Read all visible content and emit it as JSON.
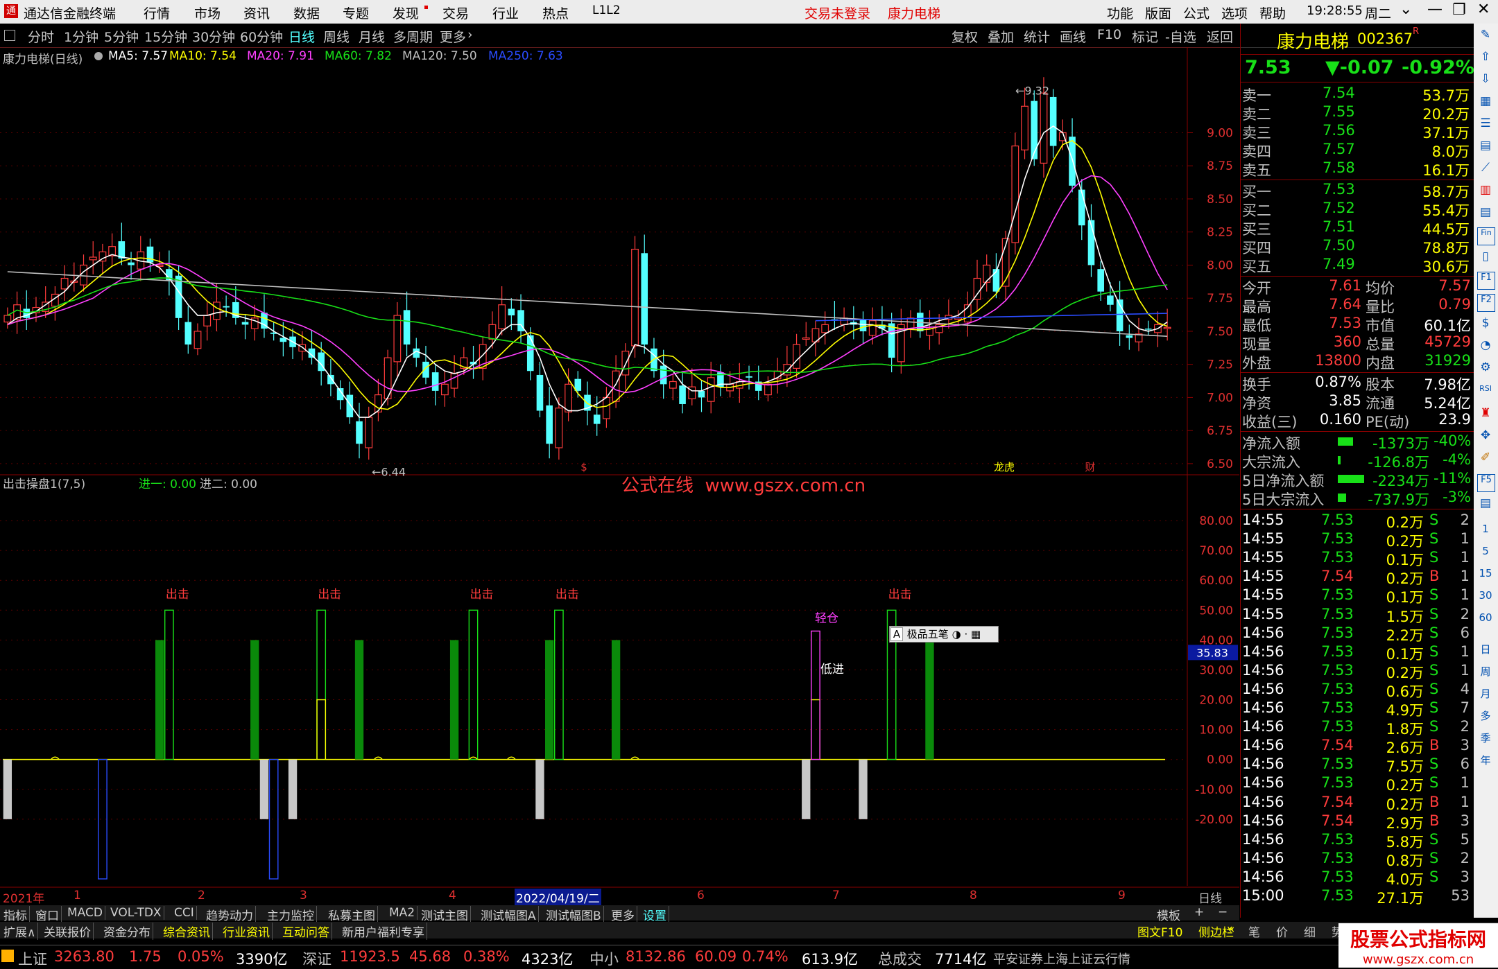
{
  "menubar": {
    "app_title": "通达信金融终端",
    "items": [
      "行情",
      "市场",
      "资讯",
      "数据",
      "专题",
      "发现",
      "交易",
      "行业",
      "热点",
      "L1L2"
    ],
    "login_status": "交易未登录",
    "stock_name": "康力电梯",
    "right_items": [
      "功能",
      "版面",
      "公式",
      "选项",
      "帮助"
    ],
    "time": "19:28:55",
    "weekday": "周二"
  },
  "toolbar": {
    "periods": [
      "分时",
      "1分钟",
      "5分钟",
      "15分钟",
      "30分钟",
      "60分钟",
      "日线",
      "周线",
      "月线",
      "多周期",
      "更多"
    ],
    "active_period": "日线",
    "right_buttons": [
      "复权",
      "叠加",
      "统计",
      "画线",
      "F10",
      "标记",
      "-自选",
      "返回"
    ]
  },
  "ma_line": {
    "title": "康力电梯(日线)",
    "ma5": "MA5: 7.57",
    "ma10": "MA10: 7.54",
    "ma20": "MA20: 7.91",
    "ma60": "MA60: 7.82",
    "ma120": "MA120: 7.50",
    "ma250": "MA250: 7.63"
  },
  "price_axis": [
    "9.00",
    "8.75",
    "8.50",
    "8.25",
    "8.00",
    "7.75",
    "7.50",
    "7.25",
    "7.00",
    "6.75",
    "6.50"
  ],
  "price_annotations": {
    "high": "9.32",
    "low": "6.44"
  },
  "event_markers": [
    "$",
    "龙虎",
    "财"
  ],
  "indicator": {
    "title": "出击操盘1(7,5)",
    "jin1": "进一: 0.00",
    "jin2": "进二: 0.00",
    "axis": [
      "80.00",
      "70.00",
      "60.00",
      "50.00",
      "40.00",
      "30.00",
      "20.00",
      "10.00",
      "0.00",
      "-10.00",
      "-20.00"
    ],
    "current_value": "35.83",
    "labels": {
      "chuji": "出击",
      "qingcang": "轻仓",
      "dijin": "低进"
    }
  },
  "watermark": "公式在线  www.gszx.com.cn",
  "popup": {
    "label": "极品五笔"
  },
  "date_axis": {
    "labels": [
      "2021年",
      "1",
      "2",
      "3",
      "4",
      "2022/04/19/二",
      "6",
      "7",
      "8",
      "9"
    ],
    "period": "日线"
  },
  "quote": {
    "name": "康力电梯",
    "code": "002367",
    "price": "7.53",
    "change": "▼-0.07",
    "pct": "-0.92%",
    "asks": [
      {
        "label": "卖五",
        "price": "7.58",
        "vol": "16.1万"
      },
      {
        "label": "卖四",
        "price": "7.57",
        "vol": "8.0万"
      },
      {
        "label": "卖三",
        "price": "7.56",
        "vol": "37.1万"
      },
      {
        "label": "卖二",
        "price": "7.55",
        "vol": "20.2万"
      },
      {
        "label": "卖一",
        "price": "7.54",
        "vol": "53.7万"
      }
    ],
    "bids": [
      {
        "label": "买一",
        "price": "7.53",
        "vol": "58.7万"
      },
      {
        "label": "买二",
        "price": "7.52",
        "vol": "55.4万"
      },
      {
        "label": "买三",
        "price": "7.51",
        "vol": "44.5万"
      },
      {
        "label": "买四",
        "price": "7.50",
        "vol": "78.8万"
      },
      {
        "label": "买五",
        "price": "7.49",
        "vol": "30.6万"
      }
    ],
    "stats": [
      {
        "l1": "今开",
        "v1": "7.61",
        "l2": "均价",
        "v2": "7.57"
      },
      {
        "l1": "最高",
        "v1": "7.64",
        "l2": "量比",
        "v2": "0.79"
      },
      {
        "l1": "最低",
        "v1": "7.53",
        "l2": "市值",
        "v2": "60.1亿"
      },
      {
        "l1": "现量",
        "v1": "360",
        "l2": "总量",
        "v2": "45729"
      },
      {
        "l1": "外盘",
        "v1": "13800",
        "l2": "内盘",
        "v2": "31929"
      }
    ],
    "stats2": [
      {
        "l1": "换手",
        "v1": "0.87%",
        "l2": "股本",
        "v2": "7.98亿"
      },
      {
        "l1": "净资",
        "v1": "3.85",
        "l2": "流通",
        "v2": "5.24亿"
      },
      {
        "l1": "收益(三)",
        "v1": "0.160",
        "l2": "PE(动)",
        "v2": "23.9"
      }
    ],
    "flows": [
      {
        "label": "净流入额",
        "value": "-1373万",
        "pct": "-40%"
      },
      {
        "label": "大宗流入",
        "value": "-126.8万",
        "pct": "-4%"
      },
      {
        "label": "5日净流入额",
        "value": "-2234万",
        "pct": "-11%"
      },
      {
        "label": "5日大宗流入",
        "value": "-737.9万",
        "pct": "-3%"
      }
    ],
    "ticks": [
      [
        "14:55",
        "7.53",
        "0.2万",
        "S",
        "2"
      ],
      [
        "14:55",
        "7.53",
        "0.2万",
        "S",
        "1"
      ],
      [
        "14:55",
        "7.53",
        "0.1万",
        "S",
        "1"
      ],
      [
        "14:55",
        "7.54",
        "0.2万",
        "B",
        "1"
      ],
      [
        "14:55",
        "7.53",
        "0.1万",
        "S",
        "1"
      ],
      [
        "14:55",
        "7.53",
        "1.5万",
        "S",
        "2"
      ],
      [
        "14:56",
        "7.53",
        "2.2万",
        "S",
        "6"
      ],
      [
        "14:56",
        "7.53",
        "0.1万",
        "S",
        "1"
      ],
      [
        "14:56",
        "7.53",
        "0.2万",
        "S",
        "1"
      ],
      [
        "14:56",
        "7.53",
        "0.6万",
        "S",
        "4"
      ],
      [
        "14:56",
        "7.53",
        "4.9万",
        "S",
        "7"
      ],
      [
        "14:56",
        "7.53",
        "1.8万",
        "S",
        "2"
      ],
      [
        "14:56",
        "7.54",
        "2.6万",
        "B",
        "3"
      ],
      [
        "14:56",
        "7.53",
        "7.5万",
        "S",
        "6"
      ],
      [
        "14:56",
        "7.53",
        "0.2万",
        "S",
        "1"
      ],
      [
        "14:56",
        "7.54",
        "0.2万",
        "B",
        "1"
      ],
      [
        "14:56",
        "7.54",
        "2.9万",
        "B",
        "3"
      ],
      [
        "14:56",
        "7.53",
        "5.8万",
        "S",
        "5"
      ],
      [
        "14:56",
        "7.53",
        "0.8万",
        "S",
        "2"
      ],
      [
        "14:56",
        "7.53",
        "4.0万",
        "S",
        "3"
      ],
      [
        "15:00",
        "7.53",
        "27.1万",
        "",
        "53"
      ]
    ]
  },
  "right_side_icons": [
    "1",
    "5",
    "15",
    "30",
    "60",
    "日",
    "周",
    "月",
    "多",
    "季",
    "年"
  ],
  "bottom_tabs": [
    "指标",
    "窗口",
    "MACD",
    "VOL-TDX",
    "CCI",
    "趋势动力",
    "主力监控",
    "私募主图",
    "MA2",
    "测试主图",
    "测试幅图A",
    "测试幅图B",
    "更多",
    "设置"
  ],
  "bottom_tabs_right": "模板",
  "bottom_tabs2": [
    "扩展∧",
    "关联报价",
    "资金分布",
    "综合资讯",
    "行业资讯",
    "互动问答",
    "新用户福利专享"
  ],
  "bottom_tabs2_right": [
    "图文F10",
    "侧边栏",
    "笔",
    "价",
    "细",
    "势"
  ],
  "statusbar": {
    "sh_label": "上证",
    "sh_val": "3263.80",
    "sh_chg": "1.75",
    "sh_pct": "0.05%",
    "sh_amt": "3390亿",
    "sz_label": "深证",
    "sz_val": "11923.5",
    "sz_chg": "45.68",
    "sz_pct": "0.38%",
    "sz_amt": "4323亿",
    "zx_label": "中小",
    "zx_val": "8132.86",
    "zx_chg": "60.09",
    "zx_pct": "0.74%",
    "zx_amt": "613.9亿",
    "total_label": "总成交",
    "total_val": "7714亿",
    "broker": "平安证券上海上证云行情",
    "site_logo": "股票公式指标网",
    "site_url": "www.gszx.com.cn"
  },
  "chart_data": {
    "type": "candlestick",
    "colors": {
      "up": "#ff3c3c",
      "down": "#54ffff",
      "ma5": "#ffffff",
      "ma10": "#ffff00",
      "ma20": "#ff40ff",
      "ma60": "#18e018",
      "ma120": "#c0c0c0",
      "ma250": "#2a4cff"
    },
    "ylim": [
      6.4,
      9.5
    ],
    "closes": [
      7.62,
      7.7,
      7.6,
      7.68,
      7.72,
      7.78,
      7.9,
      7.88,
      8.0,
      8.06,
      8.1,
      8.14,
      8.05,
      8.0,
      8.1,
      8.02,
      8.0,
      7.88,
      7.6,
      7.4,
      7.5,
      7.62,
      7.72,
      7.68,
      7.6,
      7.55,
      7.6,
      7.52,
      7.48,
      7.42,
      7.38,
      7.4,
      7.3,
      7.2,
      7.1,
      6.98,
      6.85,
      6.65,
      6.85,
      7.02,
      7.3,
      7.62,
      7.4,
      7.3,
      7.15,
      7.05,
      7.1,
      7.18,
      7.3,
      7.25,
      7.4,
      7.55,
      7.7,
      7.62,
      7.5,
      7.2,
      6.9,
      6.65,
      6.92,
      7.1,
      7.05,
      6.9,
      6.8,
      7.0,
      7.2,
      7.35,
      8.12,
      7.4,
      7.2,
      7.1,
      7.12,
      6.95,
      7.08,
      7.0,
      7.15,
      7.08,
      7.1,
      7.12,
      7.15,
      7.05,
      7.1,
      7.2,
      7.25,
      7.4,
      7.45,
      7.52,
      7.55,
      7.58,
      7.6,
      7.55,
      7.5,
      7.58,
      7.52,
      7.3,
      7.55,
      7.6,
      7.5,
      7.52,
      7.55,
      7.62,
      7.6,
      7.7,
      7.9,
      8.0,
      7.8,
      8.2,
      8.9,
      9.2,
      8.8,
      9.3,
      8.9,
      9.0,
      8.6,
      8.3,
      8.0,
      7.8,
      7.7,
      7.5,
      7.45,
      7.48,
      7.52,
      7.55,
      7.53
    ],
    "ma5": [
      7.55,
      7.6,
      7.62,
      7.65,
      7.7,
      7.75,
      7.8,
      7.88,
      7.95,
      8.0,
      8.05,
      8.08,
      8.06,
      8.05,
      8.03,
      8.02,
      7.98,
      7.9,
      7.8,
      7.7,
      7.62,
      7.62,
      7.64,
      7.65,
      7.62,
      7.6,
      7.58,
      7.55,
      7.5,
      7.46,
      7.42,
      7.38,
      7.32,
      7.25,
      7.15,
      7.05,
      6.95,
      6.85,
      6.85,
      6.9,
      7.0,
      7.15,
      7.3,
      7.35,
      7.32,
      7.25,
      7.2,
      7.18,
      7.2,
      7.25,
      7.32,
      7.4,
      7.5,
      7.55,
      7.55,
      7.45,
      7.3,
      7.1,
      6.95,
      6.9,
      6.9,
      6.92,
      6.95,
      7.0,
      7.1,
      7.25,
      7.4,
      7.38,
      7.32,
      7.25,
      7.2,
      7.1,
      7.05,
      7.05,
      7.08,
      7.1,
      7.1,
      7.12,
      7.12,
      7.1,
      7.12,
      7.15,
      7.2,
      7.28,
      7.35,
      7.42,
      7.48,
      7.52,
      7.55,
      7.56,
      7.55,
      7.55,
      7.52,
      7.48,
      7.5,
      7.52,
      7.53,
      7.55,
      7.58,
      7.6,
      7.62,
      7.68,
      7.78,
      7.88,
      7.95,
      8.15,
      8.4,
      8.65,
      8.85,
      9.0,
      9.05,
      9.0,
      8.8,
      8.55,
      8.3,
      8.05,
      7.85,
      7.7,
      7.58,
      7.52,
      7.5,
      7.52,
      7.57
    ],
    "indicator": {
      "ylim": [
        -40,
        90
      ],
      "chuji_bars": [
        {
          "i": 17,
          "h": 50
        },
        {
          "i": 33,
          "h": 50
        },
        {
          "i": 49,
          "h": 50
        },
        {
          "i": 58,
          "h": 50
        },
        {
          "i": 93,
          "h": 50
        }
      ],
      "green_bars": [
        {
          "i": 16,
          "h": 40
        },
        {
          "i": 26,
          "h": 40
        },
        {
          "i": 37,
          "h": 40
        },
        {
          "i": 47,
          "h": 40
        },
        {
          "i": 57,
          "h": 40
        },
        {
          "i": 64,
          "h": 40
        },
        {
          "i": 97,
          "h": 40
        }
      ],
      "yellow_bars": [
        {
          "i": 33,
          "h": 20
        },
        {
          "i": 85,
          "h": 20
        }
      ],
      "magenta_bars": [
        {
          "i": 85,
          "h": 43
        }
      ],
      "gray_neg_bars": [
        {
          "i": 0,
          "h": -20
        },
        {
          "i": 27,
          "h": -20
        },
        {
          "i": 30,
          "h": -20
        },
        {
          "i": 56,
          "h": -20
        },
        {
          "i": 84,
          "h": -20
        },
        {
          "i": 90,
          "h": -20
        }
      ],
      "blue_neg_bars": [
        {
          "i": 10,
          "h": -40
        },
        {
          "i": 28,
          "h": -40
        }
      ]
    }
  }
}
